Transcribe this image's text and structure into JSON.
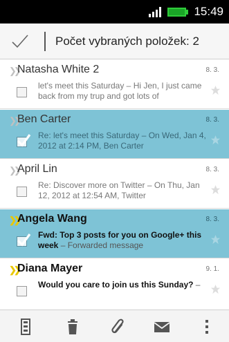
{
  "status_bar": {
    "time": "15:49"
  },
  "action_bar": {
    "title": "Počet vybraných položek: 2"
  },
  "messages": [
    {
      "sender": "Natasha White",
      "count": "2",
      "date": "8. 3.",
      "subject": "",
      "snippet": "let's meet this Saturday – Hi Jen, I just came back from my trup and got lots of",
      "selected": false,
      "unread": false
    },
    {
      "sender": "Ben Carter",
      "count": "",
      "date": "8. 3.",
      "subject": "",
      "snippet": "Re: let's meet this Saturday – On Wed, Jan 4, 2012 at 2:14 PM, Ben Carter",
      "selected": true,
      "unread": false
    },
    {
      "sender": "April Lin",
      "count": "",
      "date": "8. 3.",
      "subject": "",
      "snippet": "Re: Discover more on Twitter – On Thu, Jan 12, 2012 at 12:54 AM, Twitter",
      "selected": false,
      "unread": false
    },
    {
      "sender": "Angela Wang",
      "count": "",
      "date": "8. 3.",
      "subject": "Fwd: Top 3 posts for you on Google+ this week",
      "snippet": " – Forwarded message",
      "selected": true,
      "unread": true
    },
    {
      "sender": "Diana Mayer",
      "count": "",
      "date": "9. 1.",
      "subject": "Would you care to join us this Sunday?",
      "snippet": " –",
      "selected": false,
      "unread": true
    }
  ],
  "colors": {
    "selected_row": "#7ec3d6",
    "thread_marker": "#e9c800",
    "status_bar": "#000000"
  },
  "icons": {
    "action_bar": [
      "check-icon"
    ],
    "bottom_bar": [
      "move-to-folder-icon",
      "delete-icon",
      "attachment-icon",
      "mark-unread-icon",
      "overflow-menu-icon"
    ]
  }
}
